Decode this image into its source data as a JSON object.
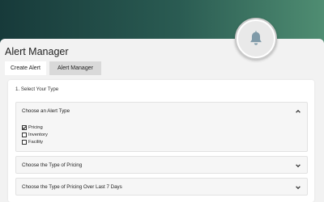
{
  "app": {
    "title": "Alert Manager"
  },
  "tabs": [
    {
      "label": "Create Alert",
      "active": true
    },
    {
      "label": "Alert Manager",
      "active": false
    }
  ],
  "step_label": "1. Select Your Type",
  "sections": [
    {
      "title": "Choose an Alert Type",
      "expanded": true,
      "options": [
        {
          "label": "Pricing",
          "checked": true
        },
        {
          "label": "Inventory",
          "checked": false
        },
        {
          "label": "Facility",
          "checked": false
        }
      ]
    },
    {
      "title": "Choose the Type of Pricing",
      "expanded": false
    },
    {
      "title": "Choose the Type of Pricing Over Last 7 Days",
      "expanded": false
    }
  ],
  "icons": {
    "bell": "bell-icon",
    "expand": "chevron-up-icon",
    "collapse": "chevron-down-icon",
    "checked": "checkbox-checked-icon",
    "unchecked": "checkbox-unchecked-icon"
  },
  "colors": {
    "header_gradient_start": "#173a3a",
    "header_gradient_end": "#4f8d72",
    "page_bg": "#f2f2f2",
    "panel_bg": "#ffffff"
  }
}
